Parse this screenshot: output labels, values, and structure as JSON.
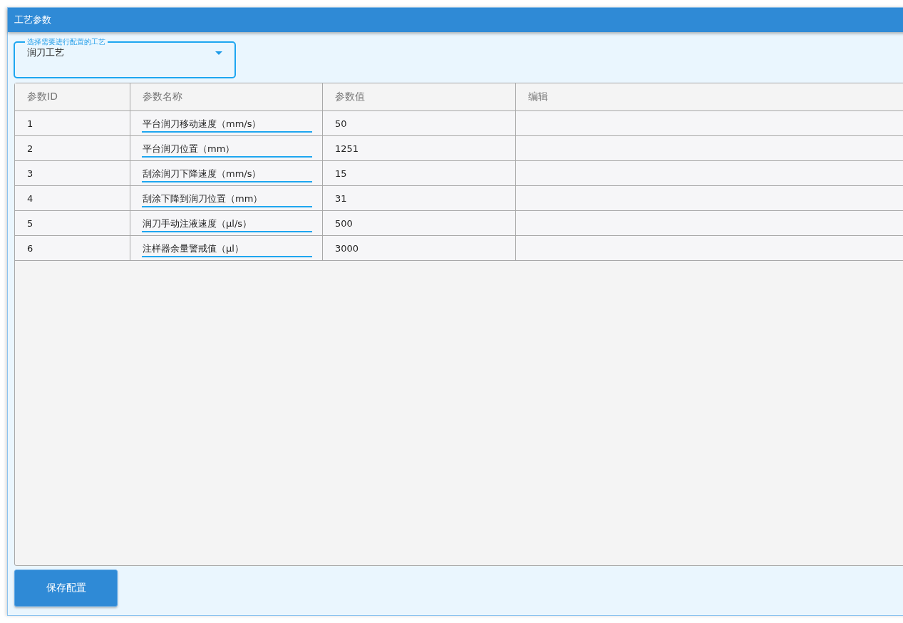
{
  "window": {
    "title": "工艺参数"
  },
  "process_select": {
    "label": "选择需要进行配置的工艺",
    "value": "润刀工艺"
  },
  "table": {
    "columns": [
      "参数ID",
      "参数名称",
      "参数值",
      "编辑"
    ],
    "rows": [
      {
        "id": "1",
        "name": "平台润刀移动速度（mm/s）",
        "value": "50"
      },
      {
        "id": "2",
        "name": "平台润刀位置（mm）",
        "value": "1251"
      },
      {
        "id": "3",
        "name": "刮涂润刀下降速度（mm/s）",
        "value": "15"
      },
      {
        "id": "4",
        "name": "刮涂下降到润刀位置（mm）",
        "value": "31"
      },
      {
        "id": "5",
        "name": "润刀手动注液速度（μl/s）",
        "value": "500"
      },
      {
        "id": "6",
        "name": "注样器余量警戒值（μl）",
        "value": "3000"
      }
    ]
  },
  "buttons": [
    "保存配置"
  ]
}
